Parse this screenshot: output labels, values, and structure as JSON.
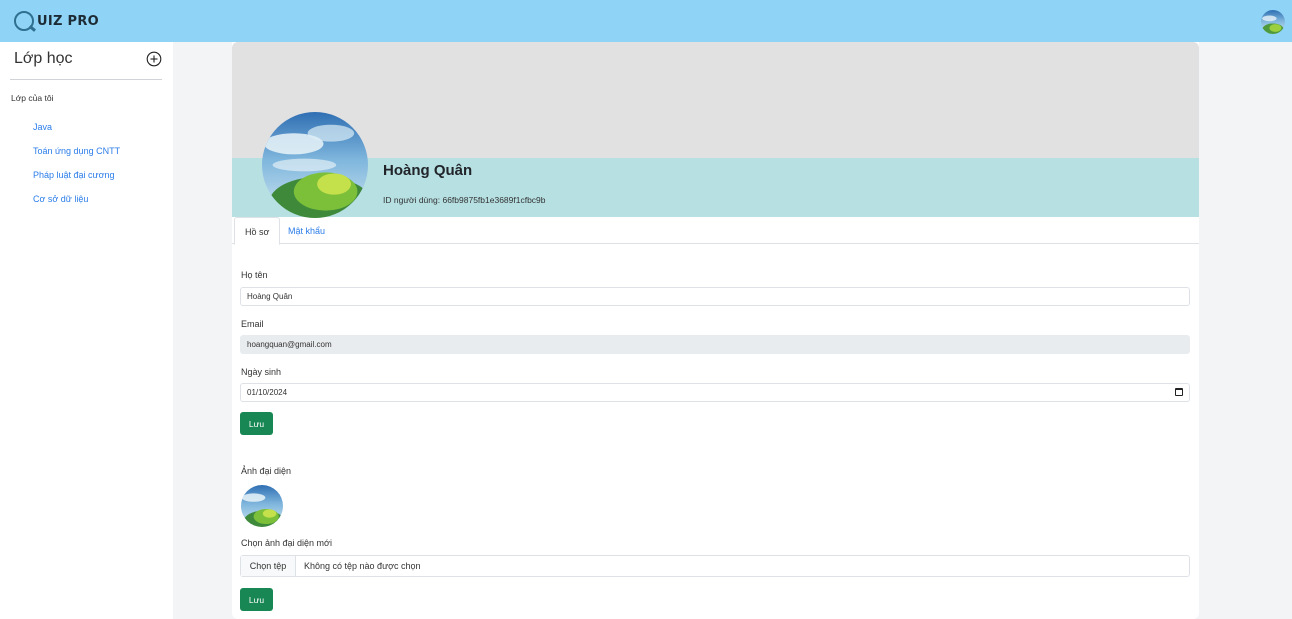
{
  "app": {
    "logo_text": "UIZ PRO"
  },
  "sidebar": {
    "title": "Lớp học",
    "section_label": "Lớp của tôi",
    "items": [
      {
        "label": "Java"
      },
      {
        "label": "Toán ứng dụng CNTT"
      },
      {
        "label": "Pháp luật đại cương"
      },
      {
        "label": "Cơ sở dữ liệu"
      }
    ]
  },
  "profile": {
    "name": "Hoàng Quân",
    "user_id_label": "ID người dùng: ",
    "user_id": "66fb9875fb1e3689f1cfbc9b"
  },
  "tabs": [
    {
      "label": "Hồ sơ",
      "active": true
    },
    {
      "label": "Mật khẩu",
      "active": false
    }
  ],
  "form": {
    "fullname_label": "Họ tên",
    "fullname_value": "Hoàng Quân",
    "email_label": "Email",
    "email_value": "hoangquan@gmail.com",
    "birthday_label": "Ngày sinh",
    "birthday_value": "01/10/2024",
    "save_label": "Lưu"
  },
  "avatar_section": {
    "label": "Ảnh đại diện",
    "choose_label": "Chọn ảnh đại diện mới",
    "file_button": "Chọn tệp",
    "file_status": "Không có tệp nào được chọn",
    "save_label": "Lưu"
  },
  "colors": {
    "topbar": "#8fd4f6",
    "accent_blue": "#2b7de9",
    "save_green": "#198754",
    "cover_gray": "#e2e1e2",
    "cover_band": "#b7e0e3"
  }
}
